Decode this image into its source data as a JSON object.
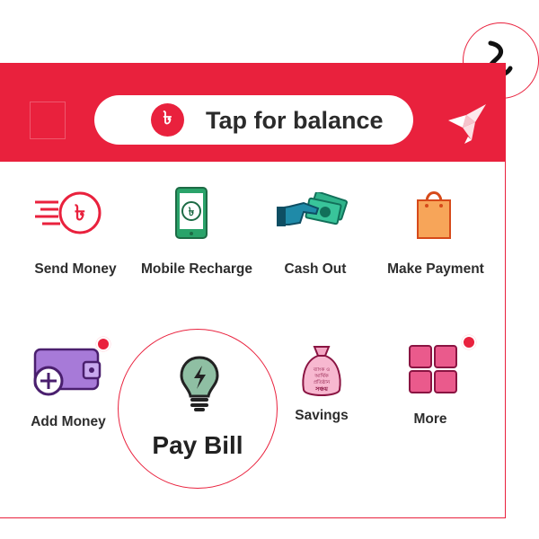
{
  "header": {
    "balance_label": "Tap for balance",
    "currency_symbol": "৳",
    "brand_color": "#e9213d"
  },
  "services": [
    {
      "label": "Send Money",
      "icon": "send-money-icon"
    },
    {
      "label": "Mobile Recharge",
      "icon": "mobile-recharge-icon"
    },
    {
      "label": "Cash Out",
      "icon": "cash-out-icon"
    },
    {
      "label": "Make Payment",
      "icon": "shopping-bag-icon"
    },
    {
      "label": "Add Money",
      "icon": "wallet-add-icon",
      "notification": true
    },
    {
      "label": "Pay Bill",
      "icon": "lightbulb-icon",
      "highlighted": true
    },
    {
      "label": "Savings",
      "icon": "savings-bag-icon",
      "bag_text": [
        "ব্যাংক ও",
        "আর্থিক",
        "প্রতিষ্ঠান",
        "সঞ্চয়"
      ]
    },
    {
      "label": "More",
      "icon": "grid-more-icon",
      "notification": true
    }
  ]
}
